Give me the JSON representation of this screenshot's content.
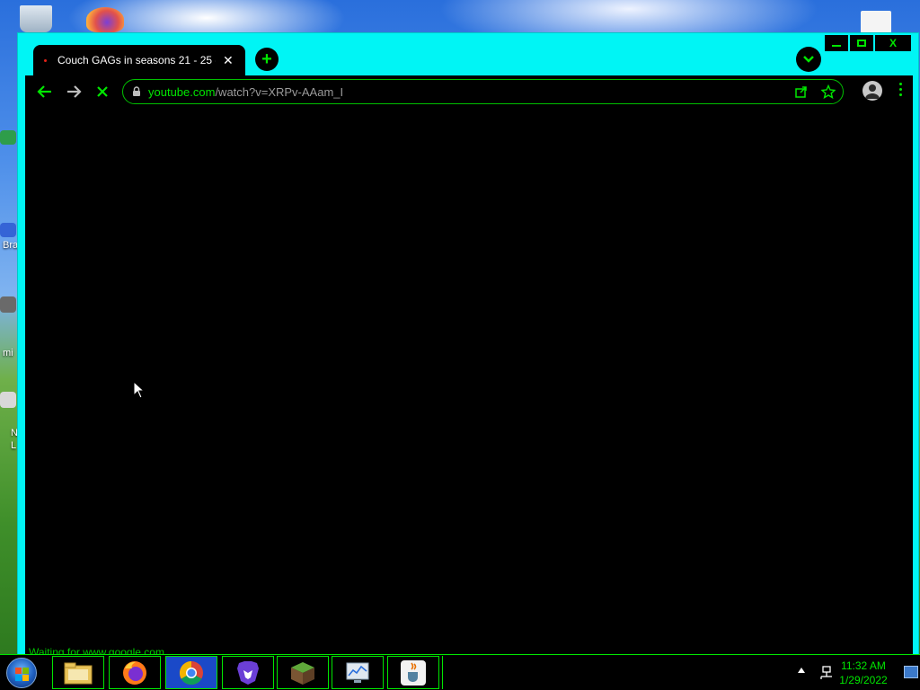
{
  "desktop": {
    "labels": [
      "Bra",
      "mi",
      "N",
      "L"
    ]
  },
  "browser": {
    "tab_title": "Couch GAGs in seasons 21 - 25 -",
    "url_host": "youtube.com",
    "url_path": "/watch?v=XRPv-AAam_I",
    "status_text": "Waiting for www.google.com..."
  },
  "window_controls": {
    "close_label": "X"
  },
  "taskbar": {
    "apps": [
      "file-explorer",
      "firefox",
      "chrome",
      "brave-nightly",
      "minecraft",
      "resource-monitor",
      "java"
    ],
    "time": "11:32 AM",
    "date": "1/29/2022"
  },
  "colors": {
    "accent": "#00e600",
    "window_frame": "#00f5f5",
    "background": "#000000"
  }
}
